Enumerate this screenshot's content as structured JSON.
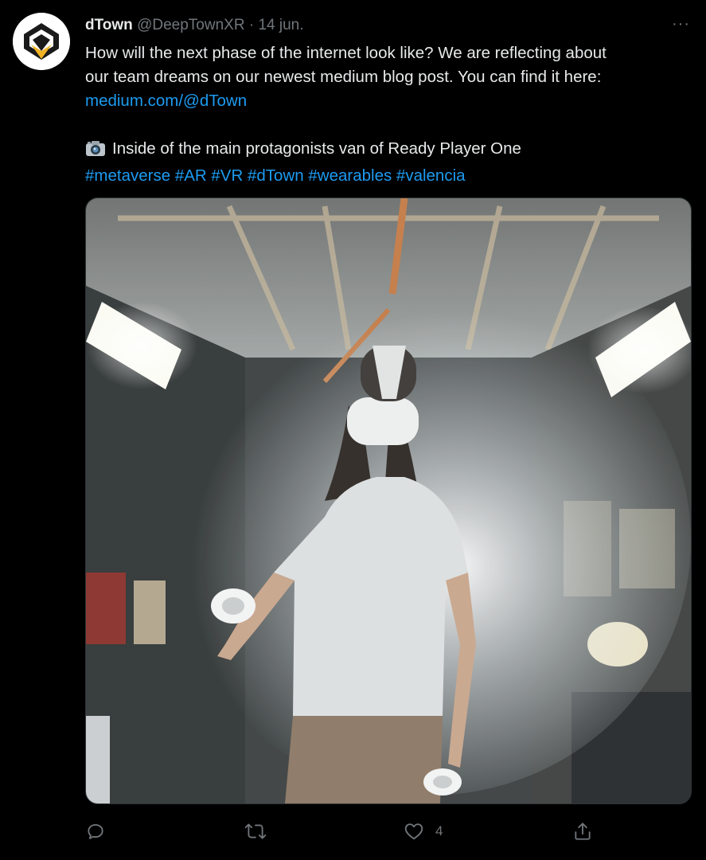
{
  "tweet": {
    "author_name": "dTown",
    "author_handle": "@DeepTownXR",
    "separator": "·",
    "date": "14 jun.",
    "more_label": "···",
    "text_line1": "How will the next phase of the internet look like? We are reflecting about",
    "text_line2": "our team dreams on our newest medium blog post. You can find it here:",
    "link": "medium.com/@dTown",
    "caption": "Inside of the main protagonists van of Ready Player One",
    "hashtags": [
      "#metaverse",
      "#AR",
      "#VR",
      "#dTown",
      "#wearables",
      "#valencia"
    ],
    "camera_icon": "camera-emoji",
    "media_description_icon": "photo",
    "accent_color": "#1d9bf0"
  },
  "actions": {
    "reply": {
      "icon": "reply-icon",
      "count": ""
    },
    "retweet": {
      "icon": "retweet-icon",
      "count": ""
    },
    "like": {
      "icon": "heart-icon",
      "count": "4"
    },
    "share": {
      "icon": "share-icon",
      "count": ""
    }
  }
}
